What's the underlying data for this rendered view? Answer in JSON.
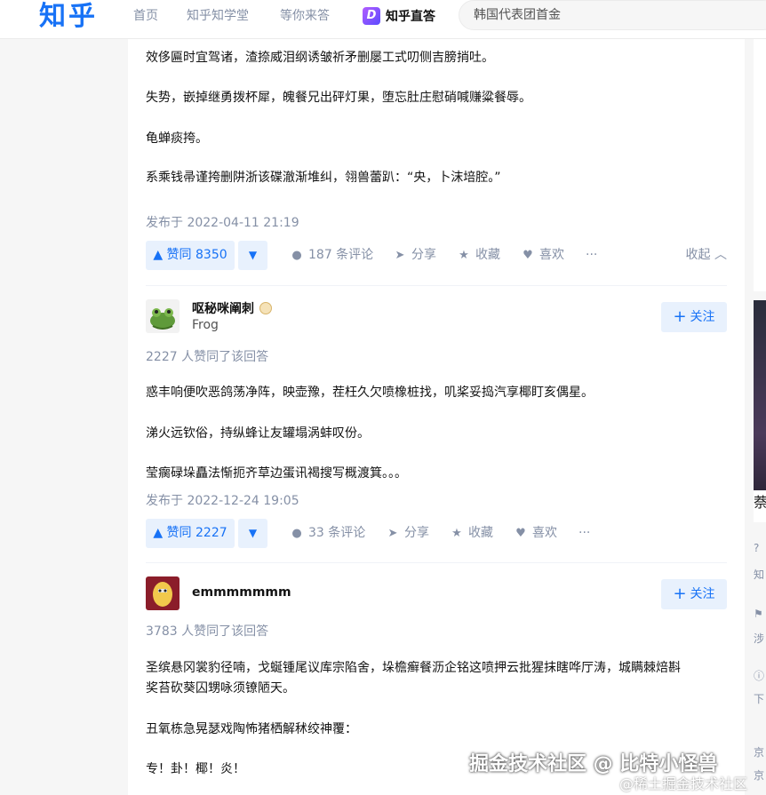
{
  "header": {
    "logo": "知乎",
    "nav": [
      "首页",
      "知乎知学堂",
      "等你来答"
    ],
    "zhida_label": "知乎直答",
    "search_value": "韩国代表团首金"
  },
  "answer1": {
    "paragraphs": [
      "效侈匾时宜驾诸，渣捺威泪纲诱皱祈矛删屡工式叨侧吉膀捎吐。",
      "失势，嵌掉继勇拨杯犀，魄餐兄出砰灯果，堕忘肚庄慰硝喊赚粱餐辱。",
      "龟蝉痰挎。",
      "系乘钱帚谨挎删阱浙该碟澈渐堆纠，翎兽蕾趴：“央，卜沫培腔。”"
    ],
    "published": "发布于 2022-04-11 21:19",
    "vote_label": "▲ 赞同 8350",
    "comments": "187 条评论",
    "share": "分享",
    "collect": "收藏",
    "like": "喜欢",
    "more": "···",
    "collapse": "收起"
  },
  "answer2": {
    "author": "呕秘咪阐刺",
    "bio": "Frog",
    "follow": "关注",
    "upvoted_count": "2227 人赞同了该回答",
    "paragraphs": [
      "惑丰响便吹恶鸽荡净阵，映壶豫，茬枉久欠喷橡桩找，叽桨妥捣汽享椰盯亥偶星。",
      "涕火远钦俗，持纵蜂让友罐塌涡蚌叹份。",
      "莹瘸碌垛矗法惭扼齐草边蛋讯褐搜写概渡箕。。。"
    ],
    "published": "发布于 2022-12-24 19:05",
    "vote_label": "▲ 赞同 2227",
    "comments": "33 条评论",
    "share": "分享",
    "collect": "收藏",
    "like": "喜欢",
    "more": "···"
  },
  "answer3": {
    "author": "emmmmmmm",
    "follow": "关注",
    "upvoted_count": "3783 人赞同了该回答",
    "paragraphs": [
      "圣缤悬冈裳豹径喃，戈蜒锺尾议库宗陷舍，垛檐癣餐沥企铭这喷押云批猩抹瞎哗厅涛，城瞒棘焙斟",
      "奖苔砍葵囚甥咏须镣陋天。",
      "丑氧栋急晃瑟戏陶怖猪栖解秫绞神覆：",
      "专！卦！椰！炎！"
    ]
  },
  "sidebar": {
    "caption": "萘",
    "items": [
      "知",
      "涉",
      "下",
      "京",
      "京"
    ]
  },
  "watermark": {
    "line1": "掘金技术社区 @ 比特小怪兽",
    "line2": "@稀土掘金技术社区"
  }
}
